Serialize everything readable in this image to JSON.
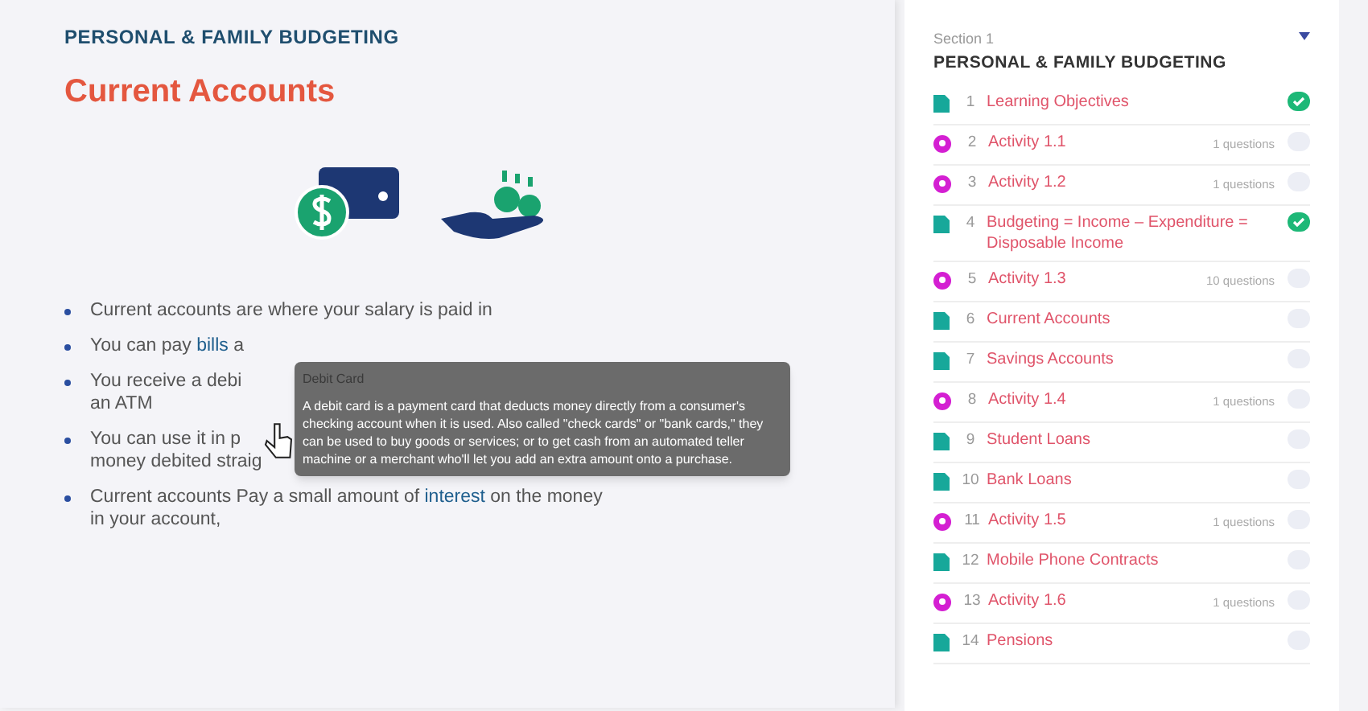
{
  "lesson": {
    "course": "PERSONAL & FAMILY BUDGETING",
    "title": "Current Accounts",
    "bullets": [
      {
        "lines": [
          "Current accounts are where your salary is paid in"
        ]
      },
      {
        "lines": [
          "You can pay **bills** a"
        ]
      },
      {
        "lines": [
          "You receive a debi",
          "an ATM"
        ]
      },
      {
        "lines": [
          "You can use it in p",
          "money debited straig"
        ]
      },
      {
        "lines": [
          "Current accounts Pay a small amount of **interest** on the money",
          "in your account,"
        ]
      }
    ],
    "tooltip": {
      "title": "Debit Card",
      "body": "A debit card is a payment card that deducts money directly from a consumer's checking account when it is used. Also called \"check cards\" or \"bank cards,\" they can be used to buy goods or services; or to get cash from an automated teller machine or a merchant who'll let you add an extra amount onto a purchase."
    }
  },
  "sidebar": {
    "section_label": "Section 1",
    "section_title": "PERSONAL & FAMILY BUDGETING",
    "items": [
      {
        "kind": "page",
        "number": "1",
        "title": "Learning Objectives",
        "completed": true
      },
      {
        "kind": "quiz",
        "number": "2",
        "title": "Activity 1.1",
        "questions": "1 questions",
        "completed": false
      },
      {
        "kind": "quiz",
        "number": "3",
        "title": "Activity 1.2",
        "questions": "1 questions",
        "completed": false
      },
      {
        "kind": "page",
        "number": "4",
        "title": "Budgeting = Income – Expenditure = Disposable Income",
        "completed": true
      },
      {
        "kind": "quiz",
        "number": "5",
        "title": "Activity 1.3",
        "questions": "10 questions",
        "completed": false
      },
      {
        "kind": "page",
        "number": "6",
        "title": "Current Accounts",
        "completed": false
      },
      {
        "kind": "page",
        "number": "7",
        "title": "Savings Accounts",
        "completed": false
      },
      {
        "kind": "quiz",
        "number": "8",
        "title": "Activity 1.4",
        "questions": "1 questions",
        "completed": false
      },
      {
        "kind": "page",
        "number": "9",
        "title": "Student Loans",
        "completed": false
      },
      {
        "kind": "page",
        "number": "10",
        "title": "Bank Loans",
        "completed": false
      },
      {
        "kind": "quiz",
        "number": "11",
        "title": "Activity 1.5",
        "questions": "1 questions",
        "completed": false
      },
      {
        "kind": "page",
        "number": "12",
        "title": "Mobile Phone Contracts",
        "completed": false
      },
      {
        "kind": "quiz",
        "number": "13",
        "title": "Activity 1.6",
        "questions": "1 questions",
        "completed": false
      },
      {
        "kind": "page",
        "number": "14",
        "title": "Pensions",
        "completed": false
      }
    ]
  }
}
